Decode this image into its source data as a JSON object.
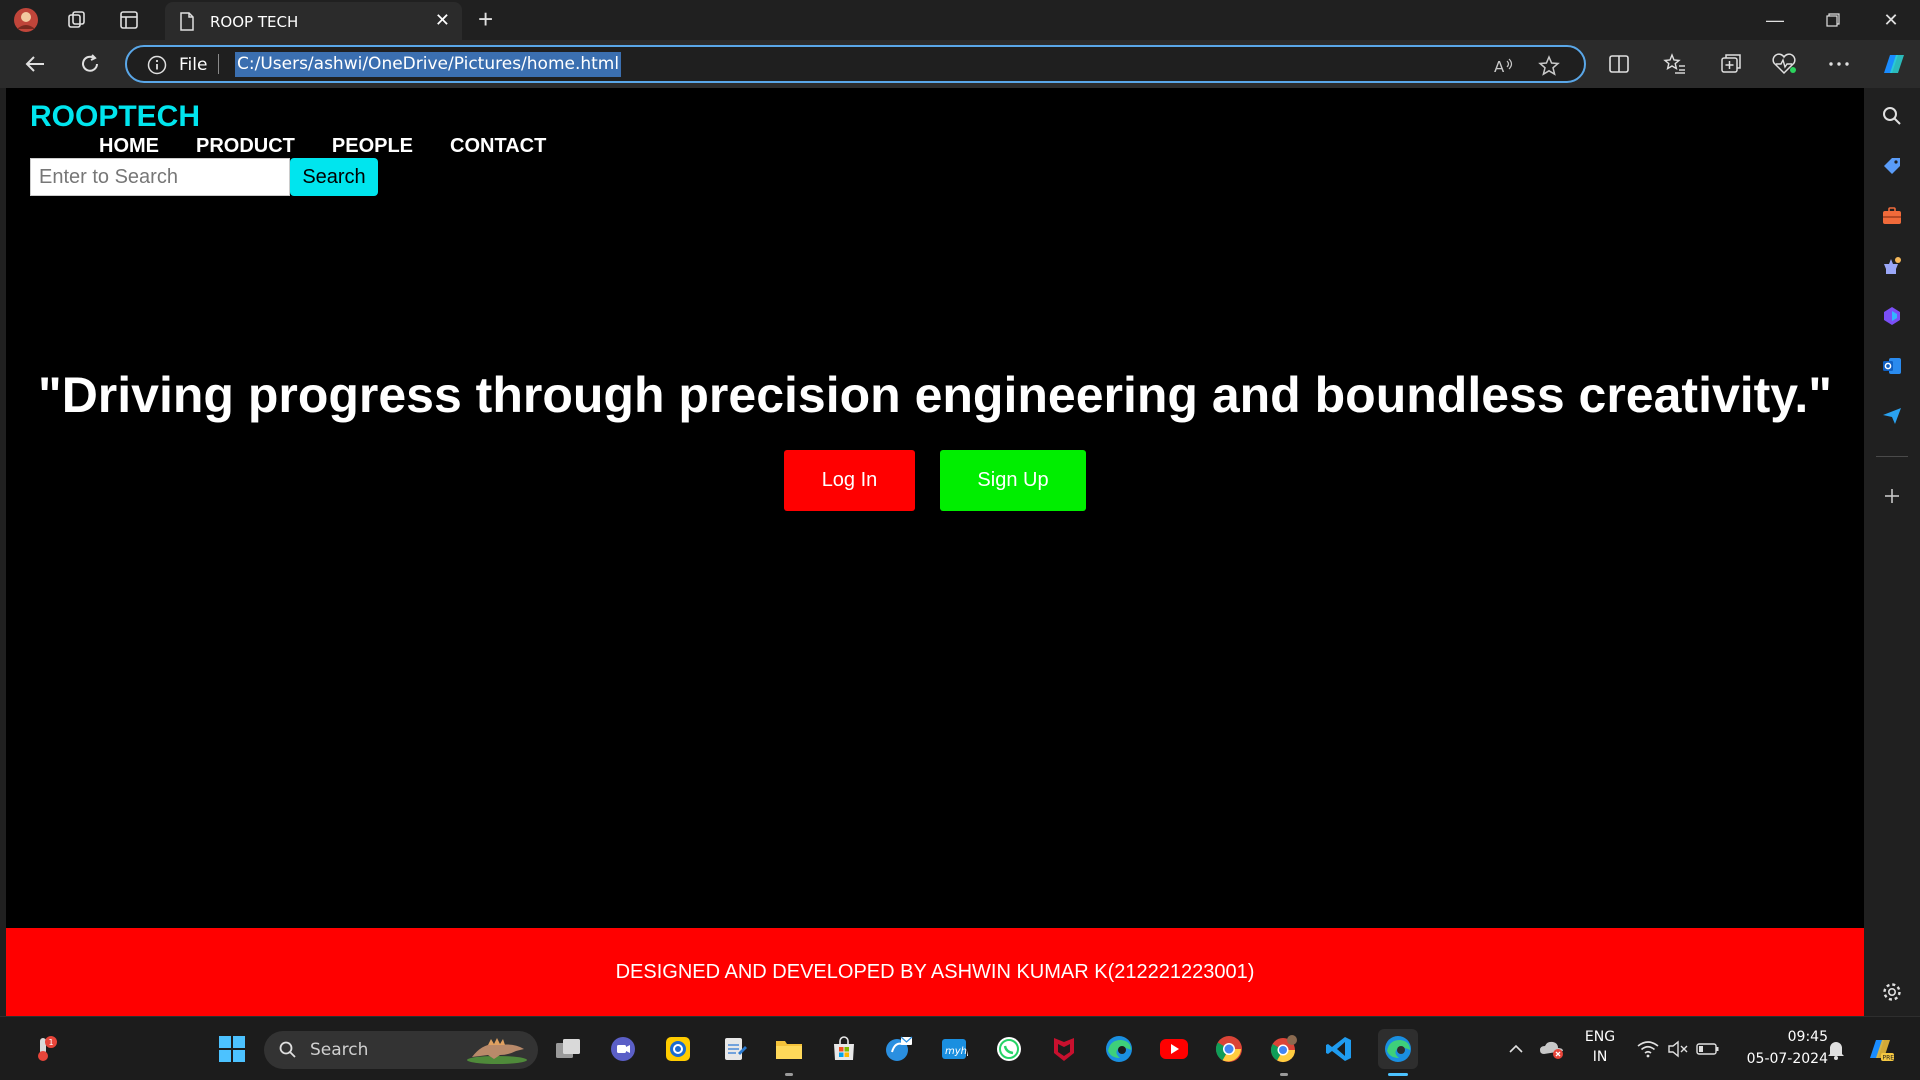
{
  "browser": {
    "tab_title": "ROOP TECH",
    "address": {
      "scheme_label": "File",
      "url": "C:/Users/ashwi/OneDrive/Pictures/home.html"
    }
  },
  "site": {
    "brand": "ROOPTECH",
    "nav": [
      "HOME",
      "PRODUCT",
      "PEOPLE",
      "CONTACT"
    ],
    "search": {
      "placeholder": "Enter to Search",
      "button": "Search"
    },
    "tagline": "\"Driving progress through precision engineering and boundless creativity.\"",
    "buttons": {
      "login": "Log In",
      "signup": "Sign Up"
    },
    "footer": "DESIGNED AND DEVELOPED BY ASHWIN KUMAR K(212221223001)",
    "colors": {
      "brand": "#00e5ee",
      "login": "#ff0000",
      "signup": "#00ee00",
      "footer": "#ff0000"
    }
  },
  "taskbar": {
    "search_label": "Search",
    "language": "ENG",
    "region": "IN",
    "time": "09:45",
    "date": "05-07-2024"
  }
}
